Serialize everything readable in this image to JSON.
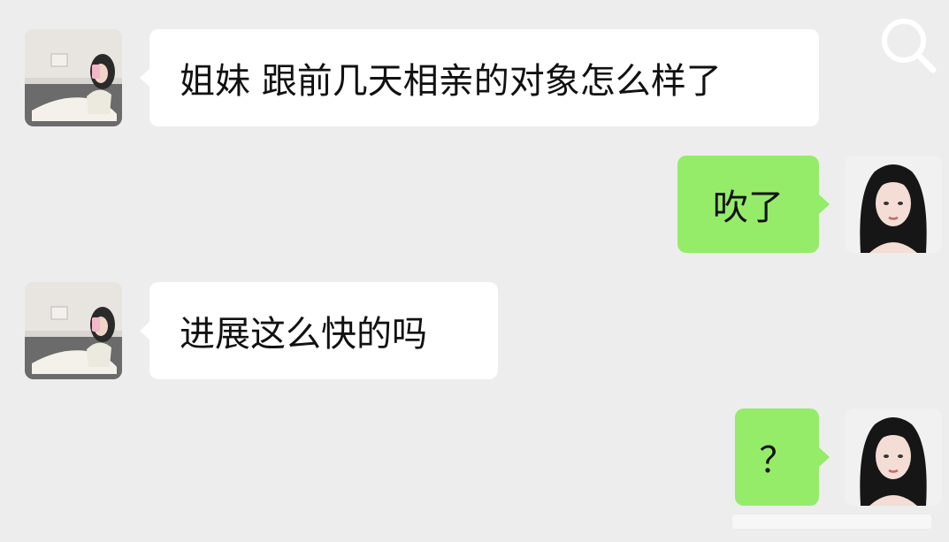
{
  "search": {
    "icon": "search-icon"
  },
  "messages": [
    {
      "sender": "contact",
      "text": "姐妹 跟前几天相亲的对象怎么样了"
    },
    {
      "sender": "me",
      "text": "吹了"
    },
    {
      "sender": "contact",
      "text": "进展这么快的吗"
    },
    {
      "sender": "me",
      "text": "？"
    }
  ],
  "colors": {
    "background": "#ededed",
    "incoming_bubble": "#ffffff",
    "outgoing_bubble": "#95ec69"
  }
}
